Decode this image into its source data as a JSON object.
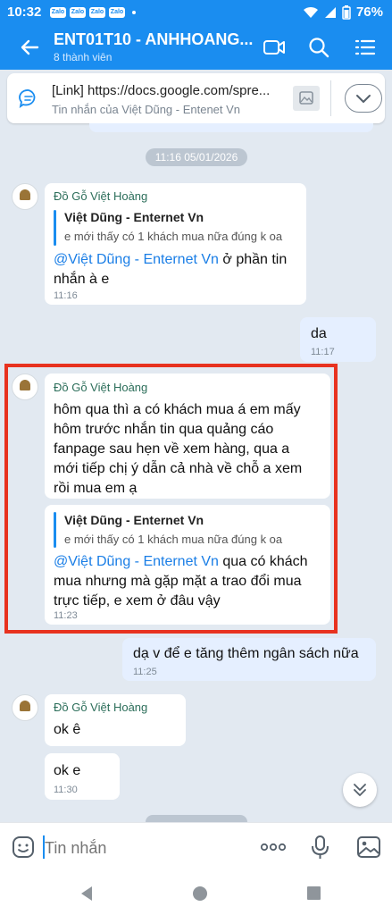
{
  "status": {
    "time": "10:32",
    "app_icons": [
      "Zalo",
      "Zalo",
      "Zalo",
      "Zalo"
    ],
    "battery": "76%"
  },
  "header": {
    "title": "ENT01T10 - ANHHOANG...",
    "subtitle": "8 thành viên"
  },
  "pinned": {
    "title": "[Link] https://docs.google.com/spre...",
    "subtitle": "Tin nhắn của Việt Dũng - Entenet Vn"
  },
  "time_separator": "11:16 05/01/2026",
  "messages": {
    "m1": {
      "sender": "Đồ Gỗ Việt Hoàng",
      "quote_name": "Việt Dũng - Enternet Vn",
      "quote_text": "e mới thấy có 1 khách mua nữa đúng k oa",
      "mention": "@Việt Dũng - Enternet Vn",
      "text_1": " ở phần tin",
      "text_2": "nhắn à e",
      "time": "11:16"
    },
    "m2": {
      "text": "da",
      "time": "11:17"
    },
    "m3": {
      "sender": "Đồ Gỗ Việt Hoàng",
      "line_1": "hôm qua thì a có khách mua á em mấy",
      "line_2": "hôm trước nhắn tin qua quảng cáo",
      "line_3": "fanpage sau hẹn về xem hàng, qua a",
      "line_4": "mới tiếp chị ý dẫn cả nhà về chỗ a xem",
      "line_5": "rồi mua em ạ"
    },
    "m4": {
      "quote_name": "Việt Dũng - Enternet Vn",
      "quote_text": "e mới thấy có 1 khách mua nữa đúng k oa",
      "mention": "@Việt Dũng - Enternet Vn",
      "text_1": " qua có khách",
      "text_2": "mua nhưng mà gặp mặt a trao đổi mua",
      "text_3": "trực tiếp, e xem ở đâu vậy",
      "time": "11:23"
    },
    "m5": {
      "text": "dạ v để e tăng thêm ngân sách nữa",
      "time": "11:25"
    },
    "m6": {
      "sender": "Đồ Gỗ Việt Hoàng",
      "text": "ok ê"
    },
    "m7": {
      "text": "ok e",
      "time": "11:30"
    }
  },
  "input": {
    "placeholder": "Tin nhắn"
  },
  "colors": {
    "accent": "#1a8df0",
    "highlight": "#e8321f",
    "mine_bubble": "#e5efff"
  },
  "icons": [
    "back-arrow-icon",
    "video-call-icon",
    "search-icon",
    "list-icon",
    "chat-bubble-icon",
    "image-icon",
    "chevron-down-icon",
    "emoji-icon",
    "more-icon",
    "mic-icon",
    "gallery-icon"
  ]
}
